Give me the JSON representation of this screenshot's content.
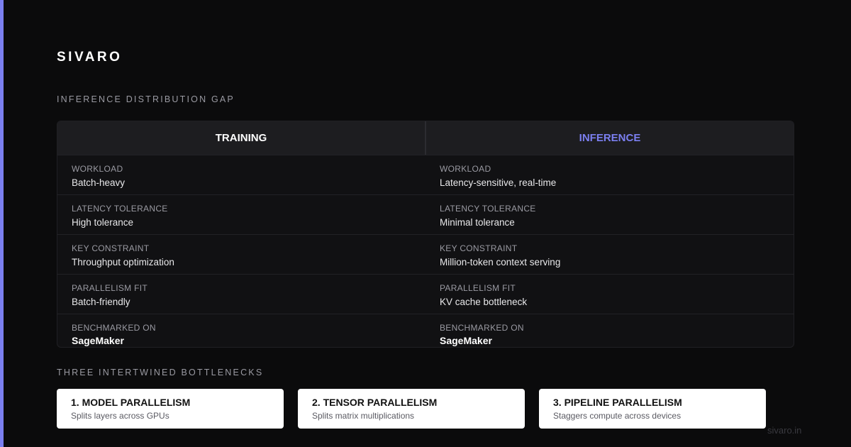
{
  "brand": "SIVARO",
  "sections": {
    "comparison_title": "INFERENCE DISTRIBUTION GAP",
    "bottlenecks_title": "THREE INTERTWINED BOTTLENECKS"
  },
  "table": {
    "headers": {
      "left": "TRAINING",
      "right": "INFERENCE"
    },
    "rows": [
      {
        "label": "WORKLOAD",
        "left": "Batch-heavy",
        "right": "Latency-sensitive, real-time"
      },
      {
        "label": "LATENCY TOLERANCE",
        "left": "High tolerance",
        "right": "Minimal tolerance"
      },
      {
        "label": "KEY CONSTRAINT",
        "left": "Throughput optimization",
        "right": "Million-token context serving"
      },
      {
        "label": "PARALLELISM FIT",
        "left": "Batch-friendly",
        "right": "KV cache bottleneck"
      },
      {
        "label": "BENCHMARKED ON",
        "left": "SageMaker",
        "right": "SageMaker"
      }
    ]
  },
  "cards": [
    {
      "title": "1. MODEL PARALLELISM",
      "desc": "Splits layers across GPUs"
    },
    {
      "title": "2. TENSOR PARALLELISM",
      "desc": "Splits matrix multiplications"
    },
    {
      "title": "3. PIPELINE PARALLELISM",
      "desc": "Staggers compute across devices"
    }
  ],
  "footer": "sivaro.in",
  "colors": {
    "accent": "#7b7ff0",
    "background": "#0b0b0c",
    "card": "#ffffff"
  }
}
